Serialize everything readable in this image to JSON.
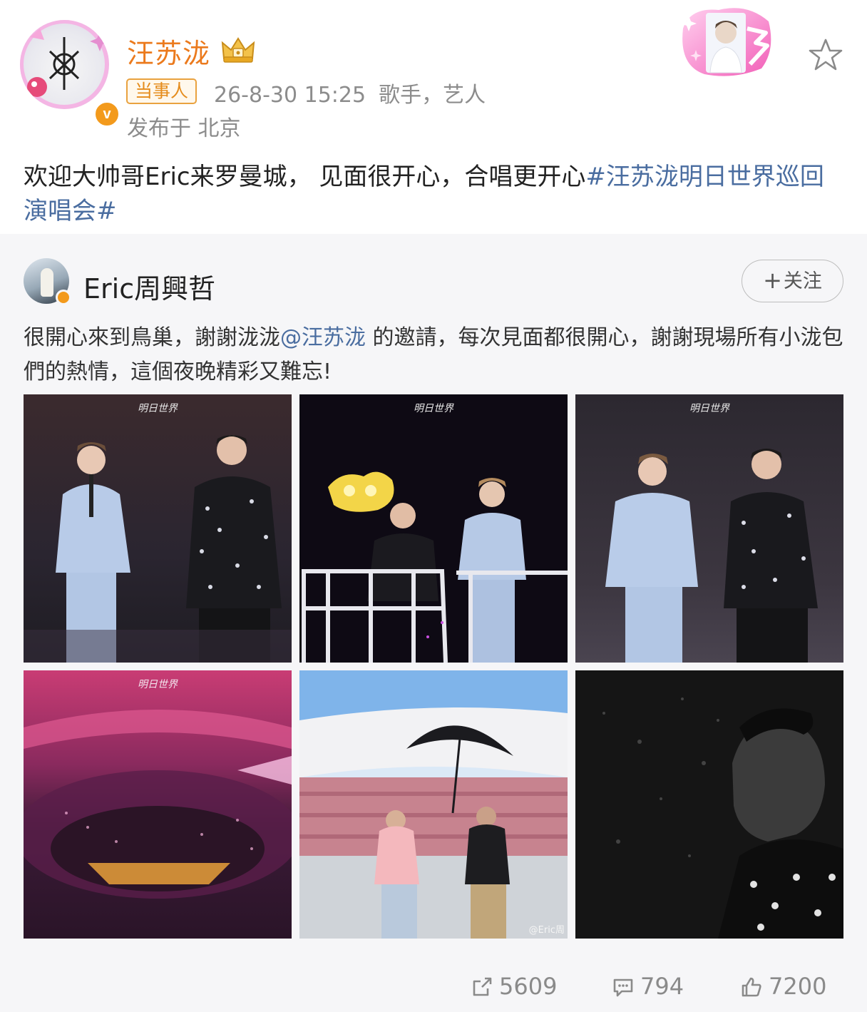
{
  "post": {
    "author_name": "汪苏泷",
    "tag": "当事人",
    "time": "26-8-30 15:25",
    "role": "歌手，艺人",
    "location": "发布于 北京",
    "text_plain": "欢迎大帅哥Eric来罗曼城， 见面很开心，合唱更开心",
    "text_topic": "#汪苏泷明日世界巡回演唱会#",
    "verified_mark": "v"
  },
  "repost": {
    "author_name": "Eric周興哲",
    "follow_label": "关注",
    "follow_plus": "+",
    "text_before": "很開心來到鳥巢，謝謝泷泷",
    "mention": "@汪苏泷",
    "text_after": " 的邀請，每次見面都很開心，謝謝現場所有小泷包們的熱情，這個夜晚精彩又難忘!",
    "photo_watermark": "@Eric周"
  },
  "actions": {
    "share_count": "5609",
    "comment_count": "794",
    "like_count": "7200"
  },
  "icons": [
    "crown-icon",
    "star-icon",
    "share-icon",
    "comment-icon",
    "like-icon",
    "verified-icon"
  ],
  "colors": {
    "name_orange": "#eb7a1d",
    "link_blue": "#4a6da0",
    "meta_gray": "#8c8c8c",
    "repost_bg": "#f6f6f8"
  }
}
